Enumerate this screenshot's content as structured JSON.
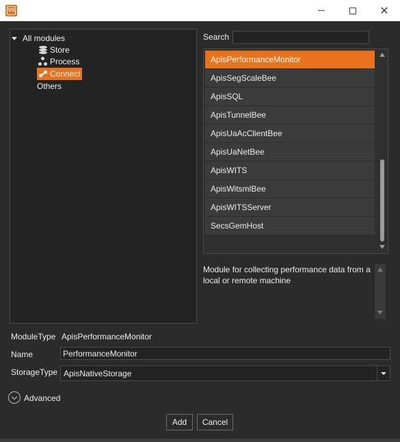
{
  "window": {
    "app_icon_text": "VS",
    "minimize_icon": "minimize-icon",
    "maximize_icon": "maximize-icon",
    "close_icon": "close-icon",
    "close_glyph": "✕"
  },
  "tree": {
    "root_label": "All modules",
    "children": [
      {
        "label": "Store",
        "icon": "database-icon"
      },
      {
        "label": "Process",
        "icon": "process-icon"
      },
      {
        "label": "Connect",
        "icon": "connect-icon",
        "selected": true
      }
    ],
    "others_label": "Others"
  },
  "search": {
    "label": "Search",
    "value": "",
    "placeholder": ""
  },
  "modules": {
    "items": [
      "ApisPerformanceMonitor",
      "ApisSegScaleBee",
      "ApisSQL",
      "ApisTunnelBee",
      "ApisUaAcClientBee",
      "ApisUaNetBee",
      "ApisWITS",
      "ApisWitsmlBee",
      "ApisWITSServer",
      "SecsGemHost"
    ],
    "selected": "ApisPerformanceMonitor"
  },
  "description": {
    "text": "Module for collecting performance data from a local or remote machine"
  },
  "form": {
    "module_type_label": "ModuleType",
    "module_type_value": "ApisPerformanceMonitor",
    "name_label": "Name",
    "name_value": "PerformanceMonitor",
    "storage_type_label": "StorageType",
    "storage_type_value": "ApisNativeStorage"
  },
  "advanced": {
    "label": "Advanced"
  },
  "buttons": {
    "add": "Add",
    "cancel": "Cancel"
  },
  "colors": {
    "accent": "#e8731c",
    "background": "#2b2b2b"
  }
}
